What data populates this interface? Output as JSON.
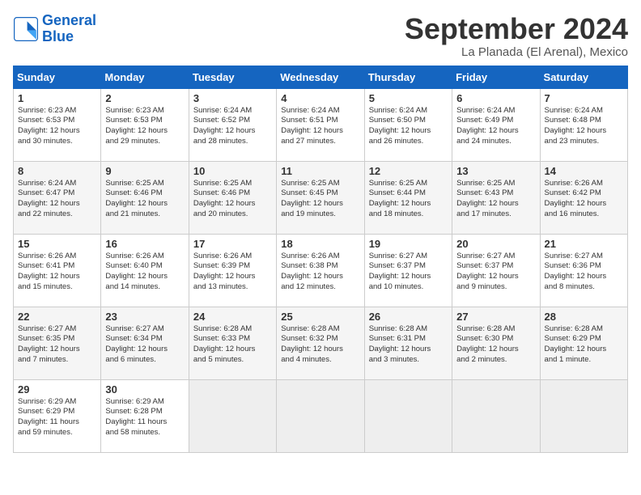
{
  "logo": {
    "line1": "General",
    "line2": "Blue"
  },
  "title": "September 2024",
  "location": "La Planada (El Arenal), Mexico",
  "days_of_week": [
    "Sunday",
    "Monday",
    "Tuesday",
    "Wednesday",
    "Thursday",
    "Friday",
    "Saturday"
  ],
  "weeks": [
    [
      {
        "day": "1",
        "lines": [
          "Sunrise: 6:23 AM",
          "Sunset: 6:53 PM",
          "Daylight: 12 hours",
          "and 30 minutes."
        ]
      },
      {
        "day": "2",
        "lines": [
          "Sunrise: 6:23 AM",
          "Sunset: 6:53 PM",
          "Daylight: 12 hours",
          "and 29 minutes."
        ]
      },
      {
        "day": "3",
        "lines": [
          "Sunrise: 6:24 AM",
          "Sunset: 6:52 PM",
          "Daylight: 12 hours",
          "and 28 minutes."
        ]
      },
      {
        "day": "4",
        "lines": [
          "Sunrise: 6:24 AM",
          "Sunset: 6:51 PM",
          "Daylight: 12 hours",
          "and 27 minutes."
        ]
      },
      {
        "day": "5",
        "lines": [
          "Sunrise: 6:24 AM",
          "Sunset: 6:50 PM",
          "Daylight: 12 hours",
          "and 26 minutes."
        ]
      },
      {
        "day": "6",
        "lines": [
          "Sunrise: 6:24 AM",
          "Sunset: 6:49 PM",
          "Daylight: 12 hours",
          "and 24 minutes."
        ]
      },
      {
        "day": "7",
        "lines": [
          "Sunrise: 6:24 AM",
          "Sunset: 6:48 PM",
          "Daylight: 12 hours",
          "and 23 minutes."
        ]
      }
    ],
    [
      {
        "day": "8",
        "lines": [
          "Sunrise: 6:24 AM",
          "Sunset: 6:47 PM",
          "Daylight: 12 hours",
          "and 22 minutes."
        ]
      },
      {
        "day": "9",
        "lines": [
          "Sunrise: 6:25 AM",
          "Sunset: 6:46 PM",
          "Daylight: 12 hours",
          "and 21 minutes."
        ]
      },
      {
        "day": "10",
        "lines": [
          "Sunrise: 6:25 AM",
          "Sunset: 6:46 PM",
          "Daylight: 12 hours",
          "and 20 minutes."
        ]
      },
      {
        "day": "11",
        "lines": [
          "Sunrise: 6:25 AM",
          "Sunset: 6:45 PM",
          "Daylight: 12 hours",
          "and 19 minutes."
        ]
      },
      {
        "day": "12",
        "lines": [
          "Sunrise: 6:25 AM",
          "Sunset: 6:44 PM",
          "Daylight: 12 hours",
          "and 18 minutes."
        ]
      },
      {
        "day": "13",
        "lines": [
          "Sunrise: 6:25 AM",
          "Sunset: 6:43 PM",
          "Daylight: 12 hours",
          "and 17 minutes."
        ]
      },
      {
        "day": "14",
        "lines": [
          "Sunrise: 6:26 AM",
          "Sunset: 6:42 PM",
          "Daylight: 12 hours",
          "and 16 minutes."
        ]
      }
    ],
    [
      {
        "day": "15",
        "lines": [
          "Sunrise: 6:26 AM",
          "Sunset: 6:41 PM",
          "Daylight: 12 hours",
          "and 15 minutes."
        ]
      },
      {
        "day": "16",
        "lines": [
          "Sunrise: 6:26 AM",
          "Sunset: 6:40 PM",
          "Daylight: 12 hours",
          "and 14 minutes."
        ]
      },
      {
        "day": "17",
        "lines": [
          "Sunrise: 6:26 AM",
          "Sunset: 6:39 PM",
          "Daylight: 12 hours",
          "and 13 minutes."
        ]
      },
      {
        "day": "18",
        "lines": [
          "Sunrise: 6:26 AM",
          "Sunset: 6:38 PM",
          "Daylight: 12 hours",
          "and 12 minutes."
        ]
      },
      {
        "day": "19",
        "lines": [
          "Sunrise: 6:27 AM",
          "Sunset: 6:37 PM",
          "Daylight: 12 hours",
          "and 10 minutes."
        ]
      },
      {
        "day": "20",
        "lines": [
          "Sunrise: 6:27 AM",
          "Sunset: 6:37 PM",
          "Daylight: 12 hours",
          "and 9 minutes."
        ]
      },
      {
        "day": "21",
        "lines": [
          "Sunrise: 6:27 AM",
          "Sunset: 6:36 PM",
          "Daylight: 12 hours",
          "and 8 minutes."
        ]
      }
    ],
    [
      {
        "day": "22",
        "lines": [
          "Sunrise: 6:27 AM",
          "Sunset: 6:35 PM",
          "Daylight: 12 hours",
          "and 7 minutes."
        ]
      },
      {
        "day": "23",
        "lines": [
          "Sunrise: 6:27 AM",
          "Sunset: 6:34 PM",
          "Daylight: 12 hours",
          "and 6 minutes."
        ]
      },
      {
        "day": "24",
        "lines": [
          "Sunrise: 6:28 AM",
          "Sunset: 6:33 PM",
          "Daylight: 12 hours",
          "and 5 minutes."
        ]
      },
      {
        "day": "25",
        "lines": [
          "Sunrise: 6:28 AM",
          "Sunset: 6:32 PM",
          "Daylight: 12 hours",
          "and 4 minutes."
        ]
      },
      {
        "day": "26",
        "lines": [
          "Sunrise: 6:28 AM",
          "Sunset: 6:31 PM",
          "Daylight: 12 hours",
          "and 3 minutes."
        ]
      },
      {
        "day": "27",
        "lines": [
          "Sunrise: 6:28 AM",
          "Sunset: 6:30 PM",
          "Daylight: 12 hours",
          "and 2 minutes."
        ]
      },
      {
        "day": "28",
        "lines": [
          "Sunrise: 6:28 AM",
          "Sunset: 6:29 PM",
          "Daylight: 12 hours",
          "and 1 minute."
        ]
      }
    ],
    [
      {
        "day": "29",
        "lines": [
          "Sunrise: 6:29 AM",
          "Sunset: 6:29 PM",
          "Daylight: 11 hours",
          "and 59 minutes."
        ]
      },
      {
        "day": "30",
        "lines": [
          "Sunrise: 6:29 AM",
          "Sunset: 6:28 PM",
          "Daylight: 11 hours",
          "and 58 minutes."
        ]
      },
      {
        "day": "",
        "lines": []
      },
      {
        "day": "",
        "lines": []
      },
      {
        "day": "",
        "lines": []
      },
      {
        "day": "",
        "lines": []
      },
      {
        "day": "",
        "lines": []
      }
    ]
  ]
}
